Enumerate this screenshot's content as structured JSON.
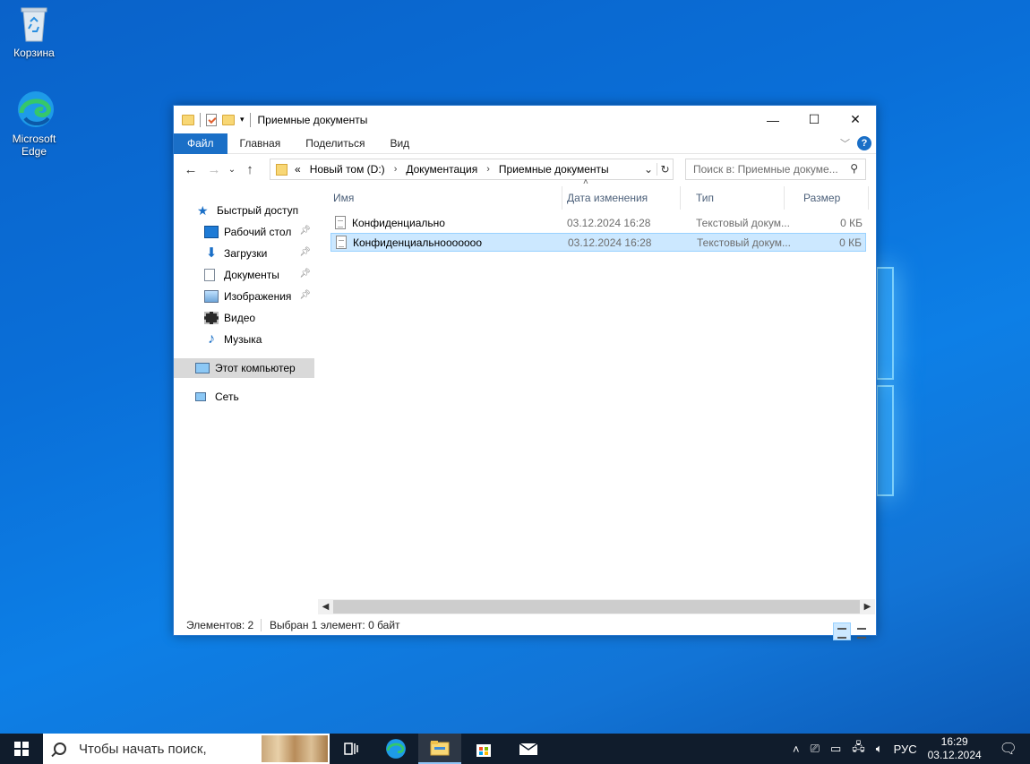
{
  "desktop": {
    "icons": [
      {
        "label": "Корзина",
        "icon": "recycle-bin-icon"
      },
      {
        "label": "Microsoft Edge",
        "icon": "edge-icon"
      }
    ]
  },
  "window": {
    "title": "Приемные документы",
    "controls": {
      "minimize": "—",
      "maximize": "☐",
      "close": "✕"
    },
    "ribbon_tabs": [
      "Файл",
      "Главная",
      "Поделиться",
      "Вид"
    ],
    "address": {
      "overflow": "«",
      "segments": [
        "Новый том (D:)",
        "Документация",
        "Приемные документы"
      ]
    },
    "search_placeholder": "Поиск в: Приемные докуме...",
    "nav": {
      "quick_access": "Быстрый доступ",
      "items": [
        "Рабочий стол",
        "Загрузки",
        "Документы",
        "Изображения",
        "Видео",
        "Музыка"
      ],
      "this_pc": "Этот компьютер",
      "network": "Сеть"
    },
    "columns": [
      "Имя",
      "Дата изменения",
      "Тип",
      "Размер"
    ],
    "files": [
      {
        "name": "Конфиденциально",
        "date": "03.12.2024 16:28",
        "type": "Текстовый докум...",
        "size": "0 КБ",
        "selected": false
      },
      {
        "name": "Конфиденциальноoooooo",
        "date": "03.12.2024 16:28",
        "type": "Текстовый докум...",
        "size": "0 КБ",
        "selected": true
      }
    ],
    "status": {
      "count": "Элементов: 2",
      "selection": "Выбран 1 элемент: 0 байт"
    }
  },
  "taskbar": {
    "search_placeholder": "Чтобы начать поиск,",
    "language": "РУС",
    "time": "16:29",
    "date": "03.12.2024"
  },
  "colors": {
    "accent": "#1a6fc7",
    "selection": "#cce8ff",
    "taskbar": "#101c2c"
  }
}
